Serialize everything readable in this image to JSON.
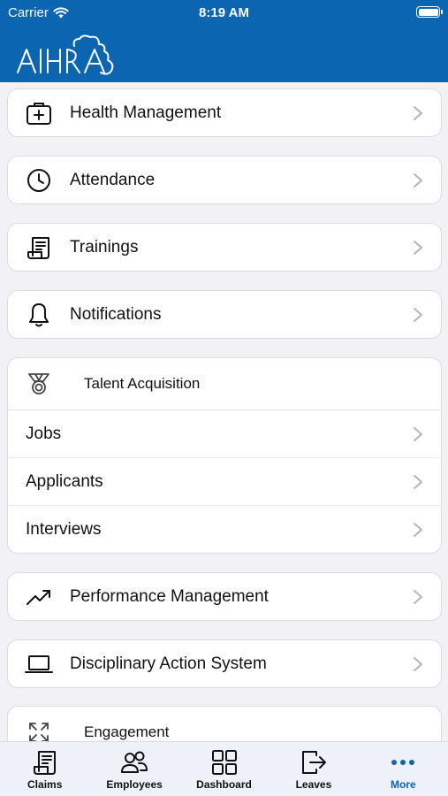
{
  "status_bar": {
    "carrier": "Carrier",
    "time": "8:19 AM"
  },
  "brand": {
    "name": "AIHRA",
    "primary_color": "#0b65b1"
  },
  "menu": [
    {
      "label": "Health Management",
      "icon": "first-aid-kit-icon"
    },
    {
      "label": "Attendance",
      "icon": "clock-icon"
    },
    {
      "label": "Trainings",
      "icon": "scroll-icon"
    },
    {
      "label": "Notifications",
      "icon": "bell-icon"
    }
  ],
  "talent_acquisition": {
    "title": "Talent Acquisition",
    "icon": "medal-icon",
    "items": [
      {
        "label": "Jobs"
      },
      {
        "label": "Applicants"
      },
      {
        "label": "Interviews"
      }
    ]
  },
  "menu_lower": [
    {
      "label": "Performance Management",
      "icon": "trending-up-icon"
    },
    {
      "label": "Disciplinary Action System",
      "icon": "laptop-icon"
    }
  ],
  "engagement": {
    "title": "Engagement",
    "icon": "expand-arrows-icon"
  },
  "tabbar": {
    "active": "More",
    "tabs": [
      {
        "label": "Claims",
        "icon": "claims-icon"
      },
      {
        "label": "Employees",
        "icon": "people-icon"
      },
      {
        "label": "Dashboard",
        "icon": "grid-icon"
      },
      {
        "label": "Leaves",
        "icon": "logout-icon"
      },
      {
        "label": "More",
        "icon": "more-dots-icon"
      }
    ]
  }
}
